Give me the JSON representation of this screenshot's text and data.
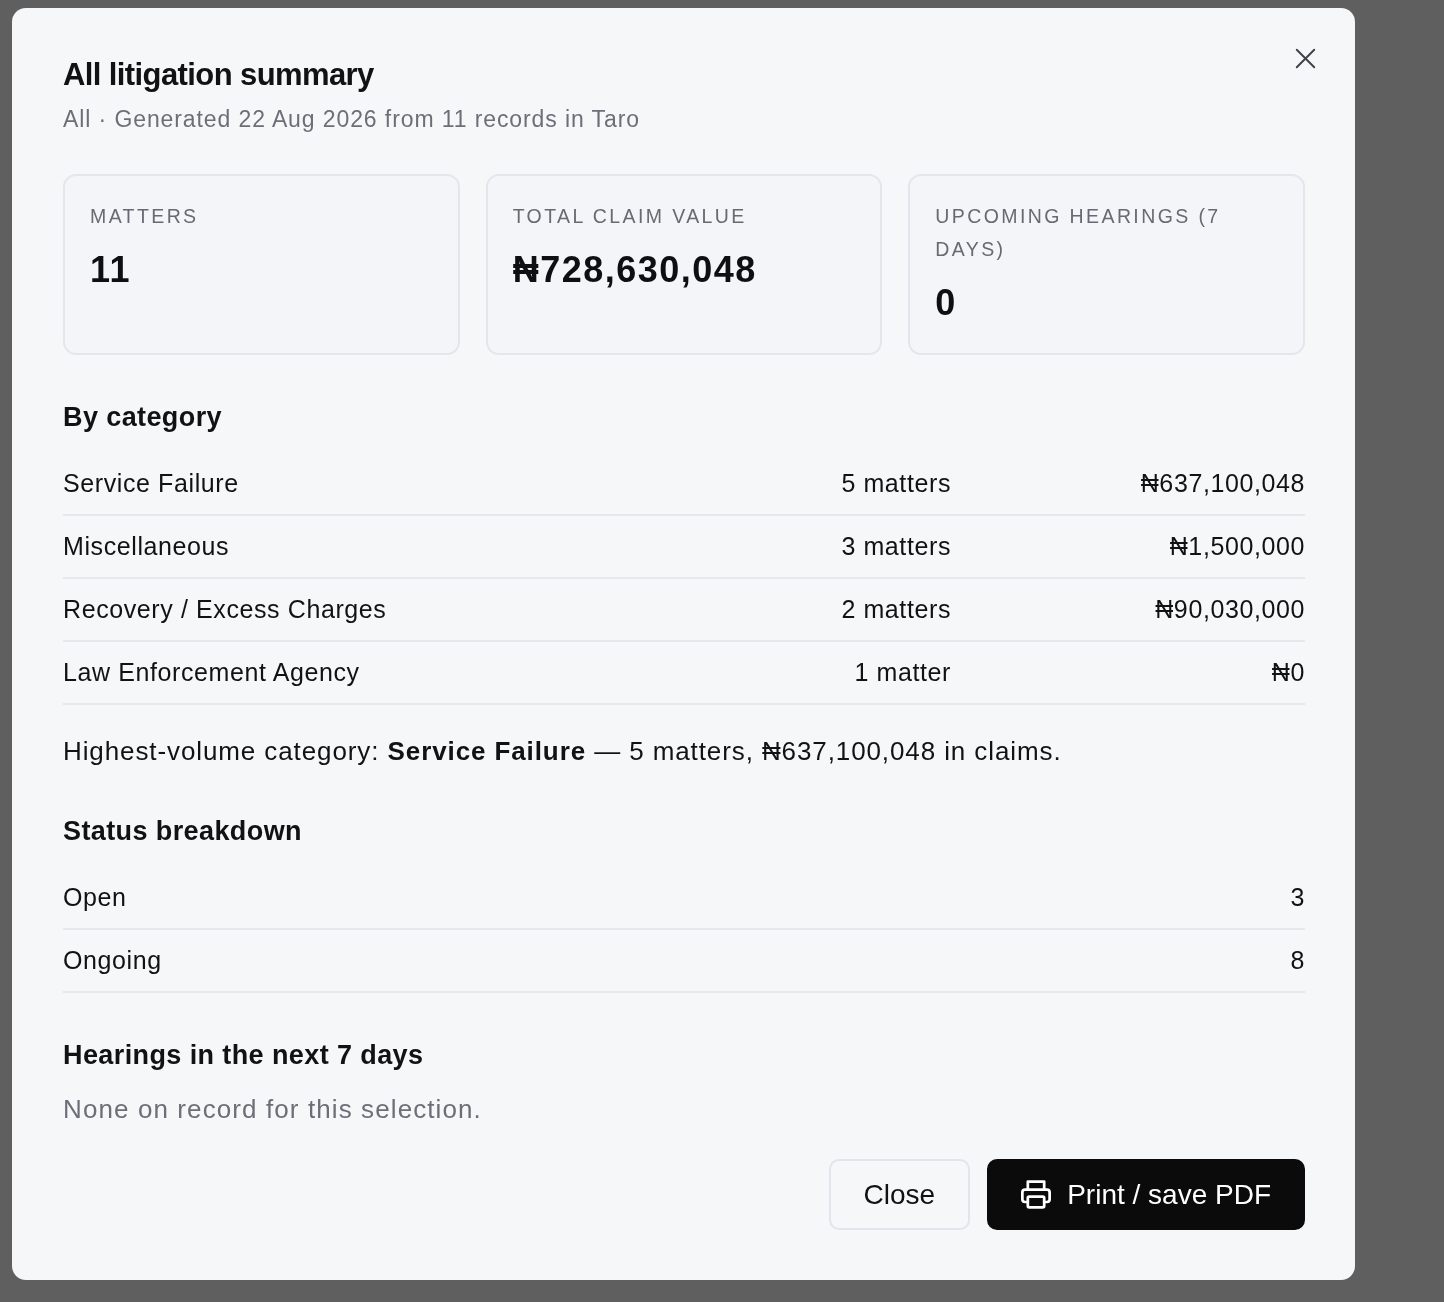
{
  "dialog": {
    "title": "All litigation summary",
    "subtitle": "All · Generated 22 Aug 2026 from 11 records in Taro"
  },
  "stats": [
    {
      "label": "MATTERS",
      "value": "11"
    },
    {
      "label": "TOTAL CLAIM VALUE",
      "value": "₦728,630,048"
    },
    {
      "label": "UPCOMING HEARINGS (7 DAYS)",
      "value": "0"
    }
  ],
  "by_category": {
    "heading": "By category",
    "rows": [
      {
        "name": "Service Failure",
        "count": "5 matters",
        "amount": "₦637,100,048"
      },
      {
        "name": "Miscellaneous",
        "count": "3 matters",
        "amount": "₦1,500,000"
      },
      {
        "name": "Recovery / Excess Charges",
        "count": "2 matters",
        "amount": "₦90,030,000"
      },
      {
        "name": "Law Enforcement Agency",
        "count": "1 matter",
        "amount": "₦0"
      }
    ],
    "summary": "Highest-volume category: **Service Failure** — 5 matters, ₦637,100,048 in claims."
  },
  "status_breakdown": {
    "heading": "Status breakdown",
    "rows": [
      {
        "status": "Open",
        "count": "3"
      },
      {
        "status": "Ongoing",
        "count": "8"
      }
    ]
  },
  "hearings": {
    "heading": "Hearings in the next 7 days",
    "empty_text": "None on record for this selection."
  },
  "buttons": [
    {
      "kind": "outline",
      "label": "Close"
    },
    {
      "kind": "solid",
      "label": "Print / save PDF"
    }
  ]
}
